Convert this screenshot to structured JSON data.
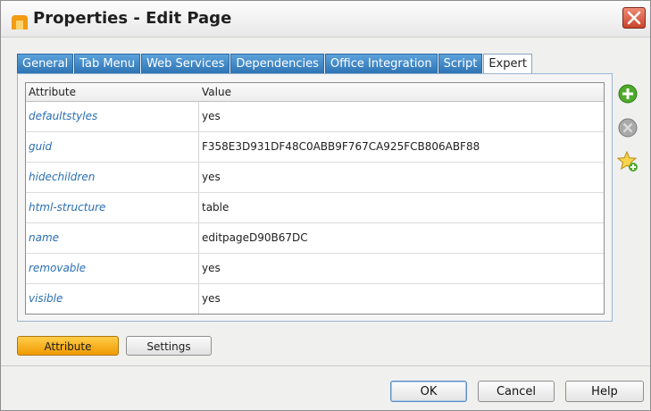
{
  "window": {
    "title": "Properties - Edit Page"
  },
  "tabs": [
    {
      "label": "General"
    },
    {
      "label": "Tab Menu"
    },
    {
      "label": "Web Services"
    },
    {
      "label": "Dependencies"
    },
    {
      "label": "Office Integration"
    },
    {
      "label": "Script"
    },
    {
      "label": "Expert",
      "active": true
    }
  ],
  "grid": {
    "header": {
      "attribute": "Attribute",
      "value": "Value"
    },
    "rows": [
      {
        "attribute": "defaultstyles",
        "value": "yes"
      },
      {
        "attribute": "guid",
        "value": "F358E3D931DF48C0ABB9F767CA925FCB806ABF88"
      },
      {
        "attribute": "hidechildren",
        "value": "yes"
      },
      {
        "attribute": "html-structure",
        "value": "table"
      },
      {
        "attribute": "name",
        "value": "editpageD90B67DC"
      },
      {
        "attribute": "removable",
        "value": "yes"
      },
      {
        "attribute": "visible",
        "value": "yes"
      }
    ]
  },
  "side_icons": [
    "add-icon",
    "remove-icon",
    "favorite-add-icon"
  ],
  "bottom_buttons": {
    "attribute": "Attribute",
    "settings": "Settings"
  },
  "dialog_buttons": {
    "ok": "OK",
    "cancel": "Cancel",
    "help": "Help"
  },
  "colors": {
    "tab_blue": "#2e74b5",
    "accent_orange": "#f09a00",
    "attr_text": "#2a6fb2",
    "close_red": "#c9442b"
  }
}
